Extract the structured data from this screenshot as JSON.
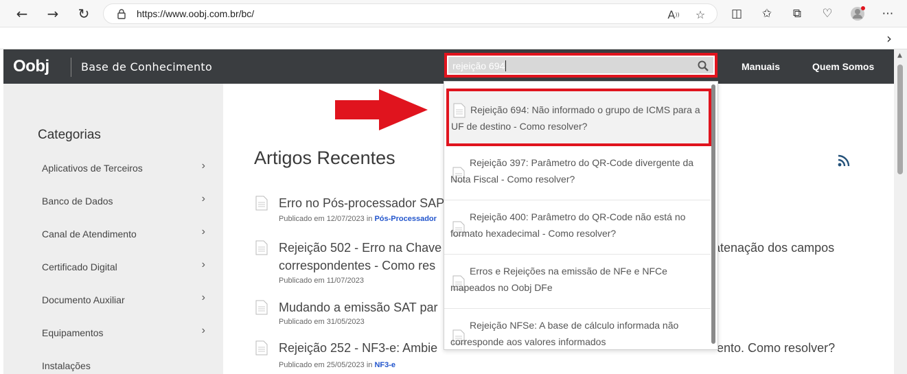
{
  "browser": {
    "url": "https://www.oobj.com.br/bc/",
    "nav_icons": [
      "back-arrow-icon",
      "forward-arrow-icon",
      "refresh-icon"
    ],
    "address_icons": [
      "read-aloud-icon",
      "favorite-star-icon"
    ],
    "toolbar_icons": [
      "split-screen-icon",
      "favorites-icon",
      "collections-icon",
      "browser-essentials-icon",
      "profile-avatar-icon",
      "more-menu-icon"
    ],
    "favbar_chevron": "›"
  },
  "site": {
    "logo": "Oobj",
    "title": "Base de Conhecimento",
    "search": {
      "value": "rejeição 694"
    },
    "nav": [
      "Manuais",
      "Quem Somos"
    ]
  },
  "sidebar": {
    "title": "Categorias",
    "items": [
      "Aplicativos de Terceiros",
      "Banco de Dados",
      "Canal de Atendimento",
      "Certificado Digital",
      "Documento Auxiliar",
      "Equipamentos",
      "Instalações"
    ]
  },
  "main": {
    "heading": "Artigos Recentes",
    "articles": [
      {
        "title": "Erro no Pós-processador SAP",
        "meta_prefix": "Publicado em 12/07/2023 in ",
        "category": "Pós-Processador"
      },
      {
        "title_line1": "Rejeição 502 - Erro na Chave",
        "title_line1_end": "atenação dos campos",
        "title_line2": "correspondentes - Como res",
        "meta_prefix": "Publicado em 11/07/2023",
        "category": ""
      },
      {
        "title": "Mudando a emissão SAT par",
        "meta_prefix": "Publicado em 31/05/2023",
        "category": ""
      },
      {
        "title": "Rejeição 252 - NF3-e: Ambie",
        "title_end": "ento. Como resolver?",
        "meta_prefix": "Publicado em 25/05/2023 in ",
        "category": "NF3-e"
      }
    ]
  },
  "dropdown": {
    "items": [
      "Rejeição 694: Não informado o grupo de ICMS para a UF de destino - Como resolver?",
      "Rejeição 397: Parâmetro do QR-Code divergente da Nota Fiscal - Como resolver?",
      "Rejeição 400: Parâmetro do QR-Code não está no formato hexadecimal - Como resolver?",
      "Erros e Rejeições na emissão de NFe e NFCe mapeados no Oobj DFe",
      "Rejeição NFSe: A base de cálculo informada não corresponde aos valores informados"
    ]
  },
  "colors": {
    "highlight": "#e0141e",
    "header": "#3a3d40",
    "link": "#2255cc"
  }
}
